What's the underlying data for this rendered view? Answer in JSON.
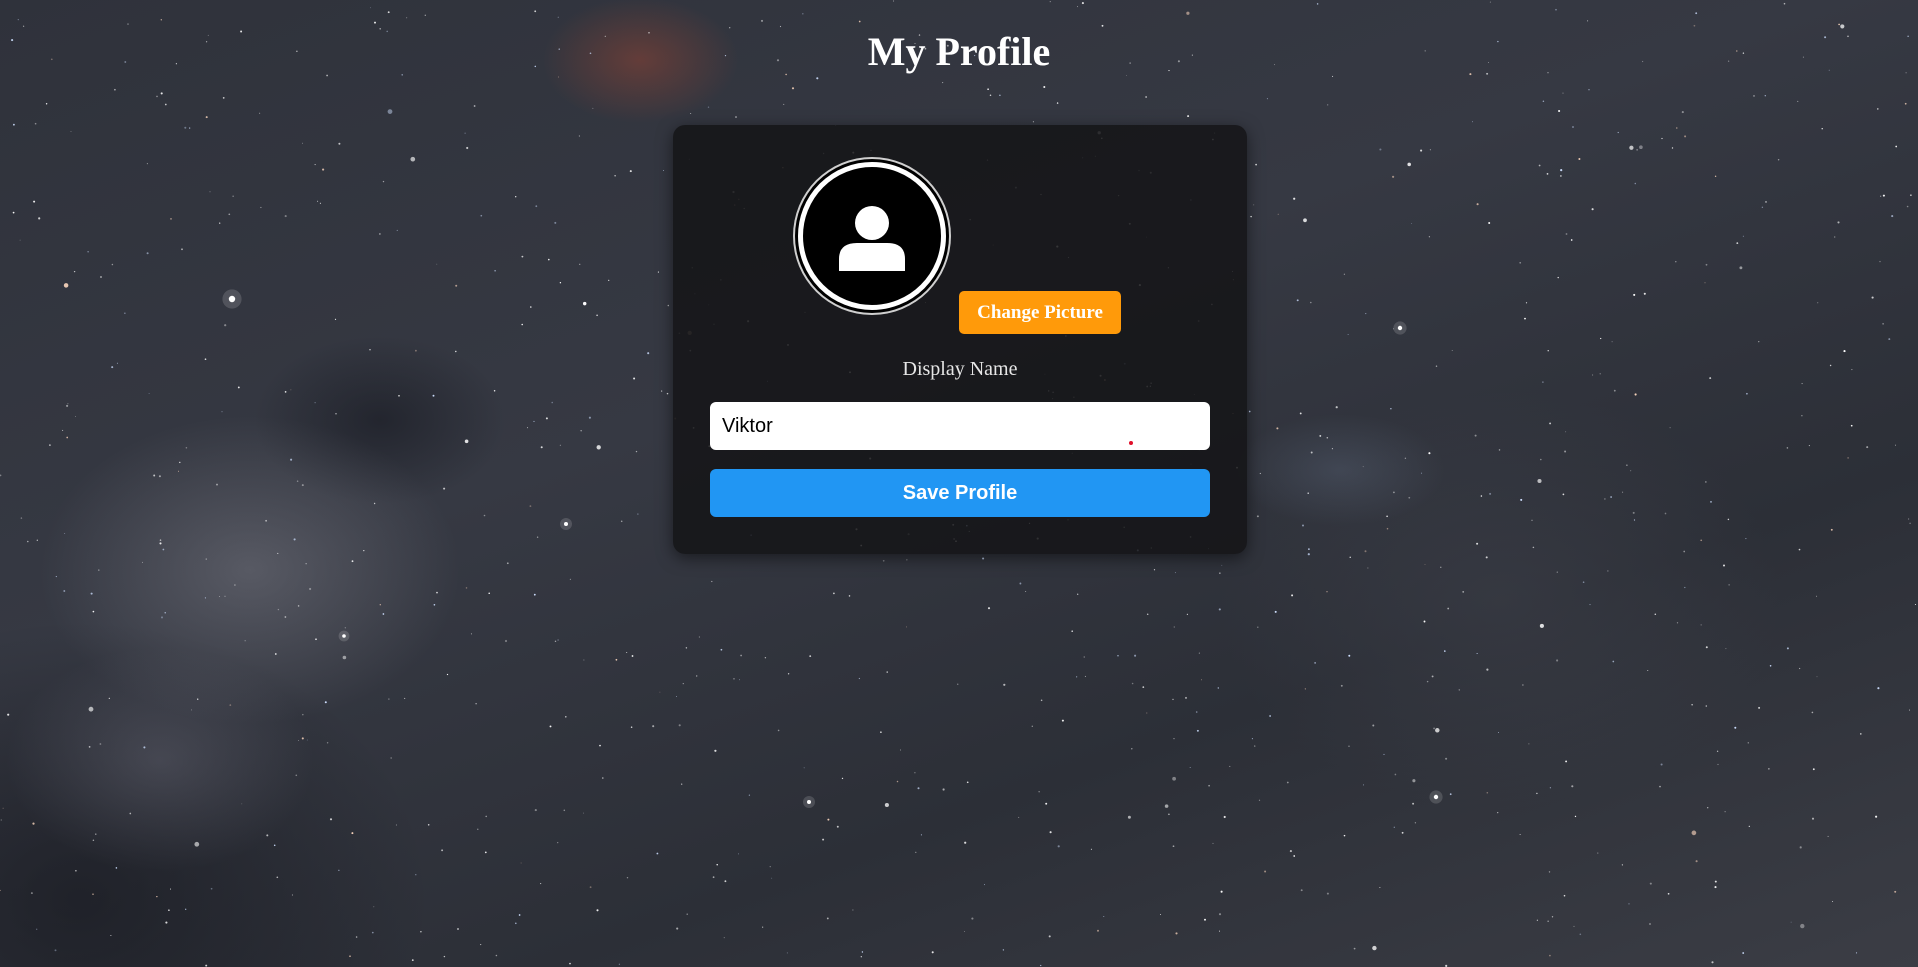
{
  "page": {
    "title": "My Profile"
  },
  "profile_card": {
    "avatar_icon": "user-silhouette-icon",
    "change_picture_label": "Change Picture",
    "display_name_label": "Display Name",
    "display_name_value": "Viktor",
    "save_label": "Save Profile"
  },
  "colors": {
    "accent_orange": "#ff9a0a",
    "accent_blue": "#2196f3",
    "card_background": "#141416",
    "title_text": "#ffffff"
  }
}
